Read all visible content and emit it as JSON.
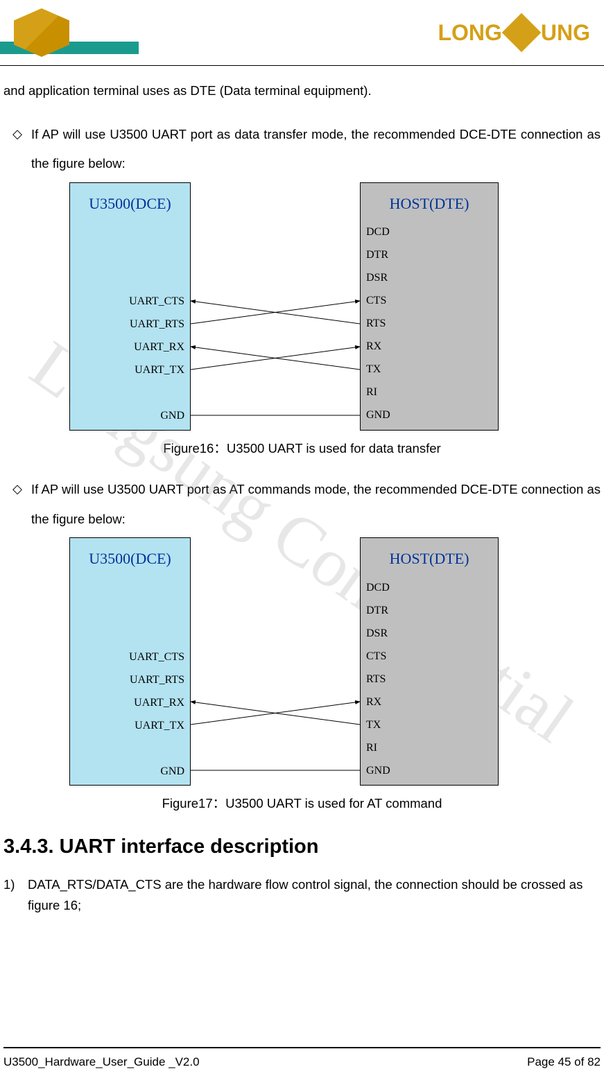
{
  "header": {
    "brand_left": "LONG",
    "brand_right": "UNG"
  },
  "watermark": "Longsung Confidential",
  "intro_text": "and application terminal uses as DTE (Data terminal equipment).",
  "bullet1_text": "If AP will use U3500 UART port as data transfer mode, the recommended DCE-DTE connection as the figure below:",
  "bullet2_text": "If AP will use U3500 UART port as AT commands mode, the recommended DCE-DTE connection as the figure below:",
  "diagram1": {
    "left_title": "U3500(DCE)",
    "right_title": "HOST(DTE)",
    "left_pins": [
      "UART_CTS",
      "UART_RTS",
      "UART_RX",
      "UART_TX",
      "",
      "GND"
    ],
    "right_pins": [
      "DCD",
      "DTR",
      "DSR",
      "CTS",
      "RTS",
      "RX",
      "TX",
      "RI",
      "GND"
    ]
  },
  "caption1": "Figure16：U3500 UART is used for data transfer",
  "diagram2": {
    "left_title": "U3500(DCE)",
    "right_title": "HOST(DTE)",
    "left_pins": [
      "UART_CTS",
      "UART_RTS",
      "UART_RX",
      "UART_TX",
      "",
      "GND"
    ],
    "right_pins": [
      "DCD",
      "DTR",
      "DSR",
      "CTS",
      "RTS",
      "RX",
      "TX",
      "RI",
      "GND"
    ]
  },
  "caption2": "Figure17：U3500 UART is used for AT command",
  "section_heading": "3.4.3. UART interface description",
  "numbered1": "DATA_RTS/DATA_CTS are the hardware flow control signal, the connection should be crossed as figure 16;",
  "footer": {
    "left": "U3500_Hardware_User_Guide _V2.0",
    "right": "Page 45 of 82"
  }
}
